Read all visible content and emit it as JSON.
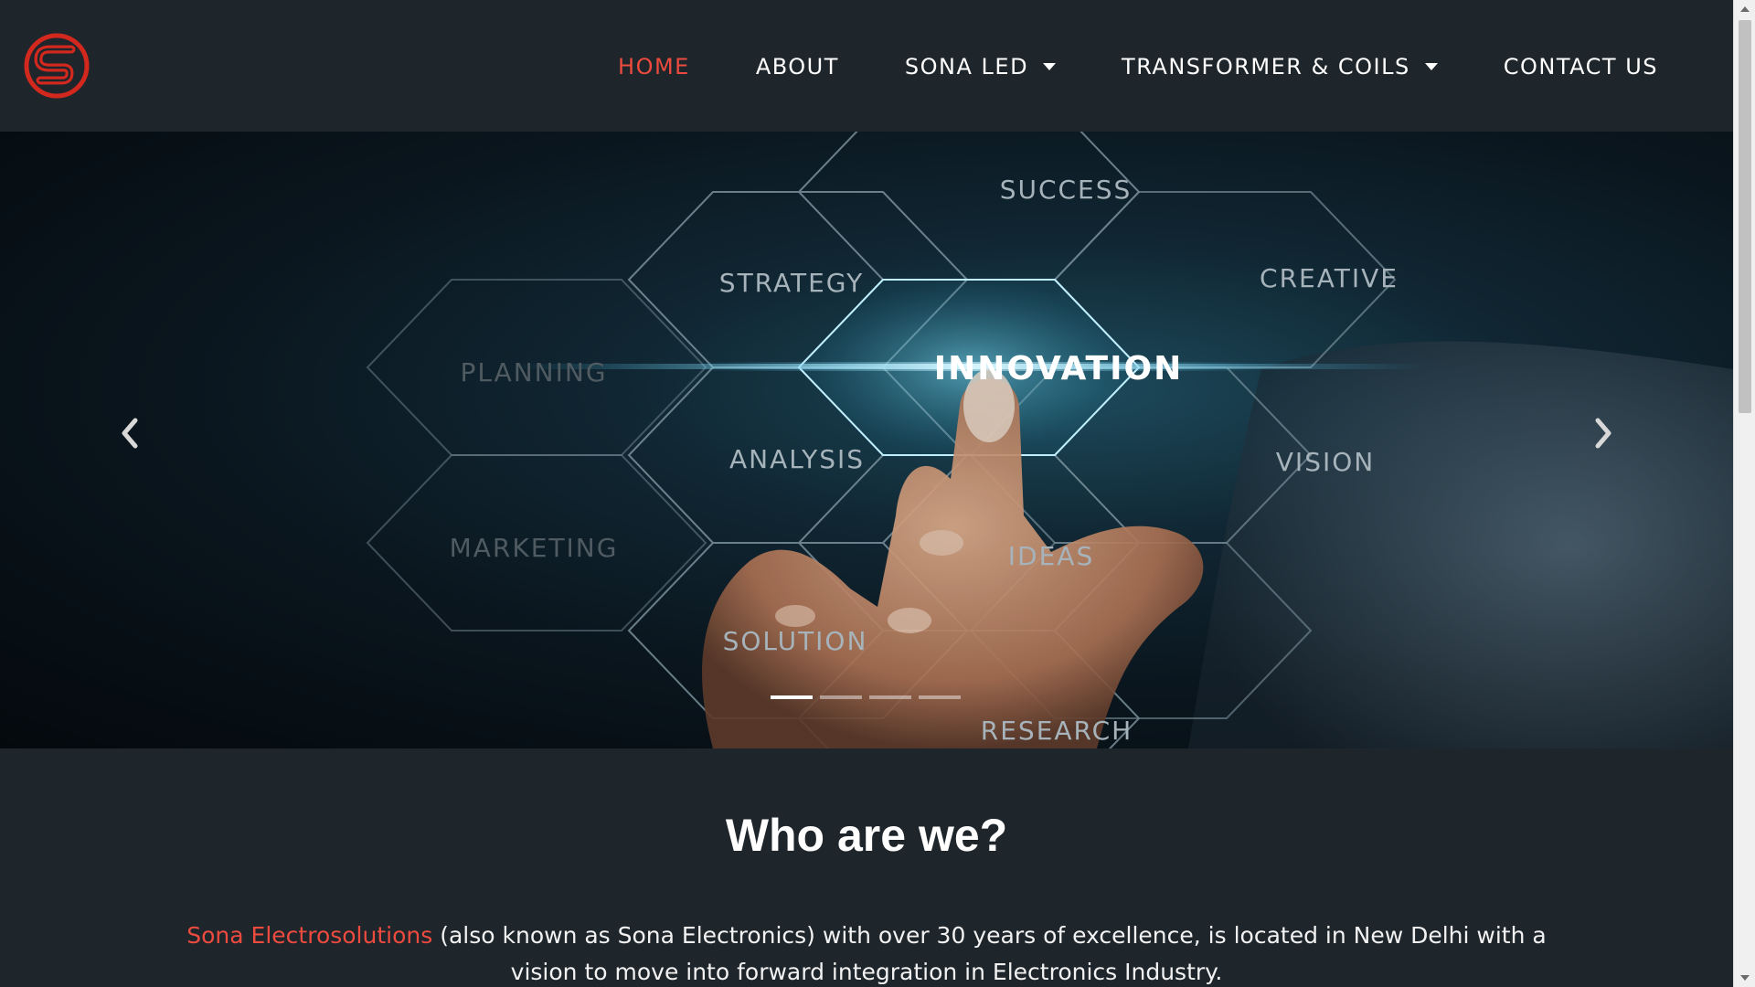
{
  "brand": {
    "logo_icon": "sona-s-logo-icon",
    "accent": "#ee4b3f"
  },
  "nav": {
    "items": [
      {
        "label": "HOME",
        "active": true
      },
      {
        "label": "ABOUT",
        "active": false
      },
      {
        "label": "SONA LED",
        "dropdown": true
      },
      {
        "label": "TRANSFORMER & COILS",
        "dropdown": true
      },
      {
        "label": "CONTACT US",
        "active": false
      }
    ]
  },
  "carousel": {
    "words": {
      "success": "SUCCESS",
      "strategy": "STRATEGY",
      "creative": "CREATIVE",
      "planning": "PLANNING",
      "innovation": "INNOVATION",
      "analysis": "ANALYSIS",
      "vision": "VISION",
      "marketing": "MARKETING",
      "ideas": "IDEAS",
      "solution": "SOLUTION",
      "research": "RESEARCH"
    },
    "prev_icon": "chevron-left-icon",
    "next_icon": "chevron-right-icon",
    "indicator_count": 4,
    "active_indicator": 1
  },
  "about": {
    "heading": "Who are we?",
    "brand_name": "Sona Electrosolutions",
    "description": " (also known as Sona Electronics) with over 30 years of excellence, is located in New Delhi with a vision to move into forward integration in Electronics Industry."
  },
  "colors": {
    "background": "#1e252b",
    "text": "#ffffff",
    "accent": "#ee4b3f"
  }
}
